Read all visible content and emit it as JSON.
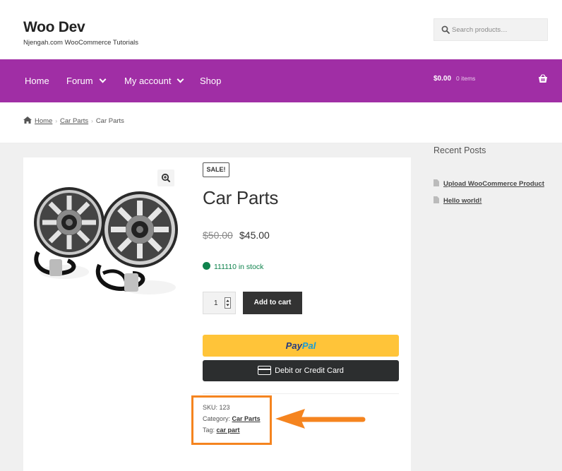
{
  "header": {
    "site_title": "Woo Dev",
    "site_description": "Njengah.com WooCommerce Tutorials",
    "search_placeholder": "Search products…"
  },
  "nav": {
    "items": [
      {
        "label": "Home",
        "has_dropdown": false
      },
      {
        "label": "Forum",
        "has_dropdown": true
      },
      {
        "label": "My account",
        "has_dropdown": true
      },
      {
        "label": "Shop",
        "has_dropdown": false
      }
    ],
    "cart_total": "$0.00",
    "cart_count": "0 items",
    "bar_color": "#a02ea5"
  },
  "breadcrumb": {
    "items": [
      "Home",
      "Car Parts",
      "Car Parts"
    ]
  },
  "product": {
    "sale_badge": "SALE!",
    "title": "Car Parts",
    "price_old": "$50.00",
    "price_new": "$45.00",
    "stock_text": "111110 in stock",
    "quantity": "1",
    "add_to_cart_label": "Add to cart",
    "paypal_label_1": "Pay",
    "paypal_label_2": "Pal",
    "card_button_label": "Debit or Credit Card",
    "meta": {
      "sku_label": "SKU:",
      "sku_value": "123",
      "category_label": "Category:",
      "category_value": "Car Parts",
      "tag_label": "Tag:",
      "tag_value": "car part"
    }
  },
  "sidebar": {
    "widget_title": "Recent Posts",
    "posts": [
      "Upload WooCommerce Product",
      "Hello world!"
    ]
  },
  "colors": {
    "accent": "#a02ea5",
    "highlight": "#f5841f",
    "stock_green": "#0f834d",
    "paypal_yellow": "#ffc439"
  }
}
